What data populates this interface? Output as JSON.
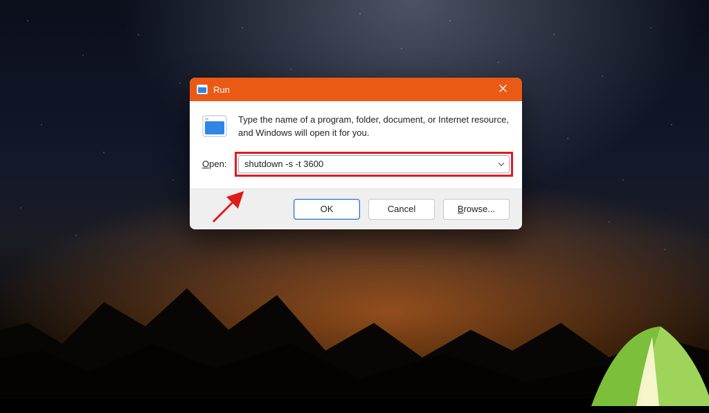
{
  "dialog": {
    "title": "Run",
    "description": "Type the name of a program, folder, document, or Internet resource, and Windows will open it for you.",
    "open_label_prefix": "O",
    "open_label_rest": "pen:",
    "input_value": "shutdown -s -t 3600",
    "buttons": {
      "ok": "OK",
      "cancel": "Cancel",
      "browse_prefix": "B",
      "browse_rest": "rowse..."
    }
  },
  "colors": {
    "accent": "#ea5a14",
    "highlight": "#e11a1a"
  }
}
